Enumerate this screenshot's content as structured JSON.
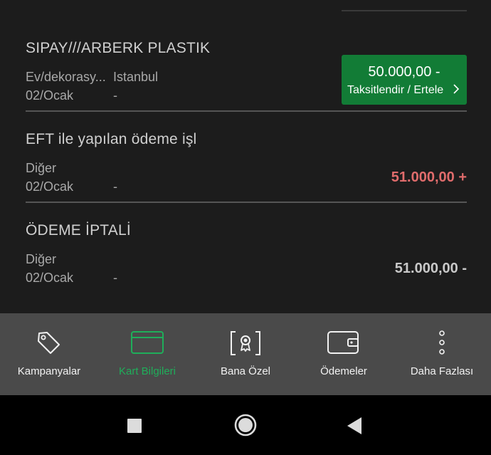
{
  "transactions": [
    {
      "title": "SIPAY///ARBERK PLASTIK",
      "category": "Ev/dekorasy...",
      "location": "Istanbul",
      "date": "02/Ocak",
      "extra": "-",
      "installment_button": {
        "amount": "50.000,00 -",
        "label": "Taksitlendir / Ertele"
      }
    },
    {
      "title": "EFT ile yapılan ödeme işl",
      "category": "Diğer",
      "date": "02/Ocak",
      "extra": "-",
      "amount": "51.000,00 +"
    },
    {
      "title": "ÖDEME İPTALİ",
      "category": "Diğer",
      "date": "02/Ocak",
      "extra": "-",
      "amount": "51.000,00 -"
    }
  ],
  "tabs": [
    {
      "label": "Kampanyalar",
      "icon": "tag-icon"
    },
    {
      "label": "Kart Bilgileri",
      "icon": "card-icon",
      "active": true
    },
    {
      "label": "Bana Özel",
      "icon": "badge-icon"
    },
    {
      "label": "Ödemeler",
      "icon": "wallet-icon"
    },
    {
      "label": "Daha Fazlası",
      "icon": "more-vertical-icon"
    }
  ],
  "colors": {
    "accent_green": "#127c36",
    "active_tab": "#1fae5a",
    "credit_red": "#e06c6c"
  }
}
